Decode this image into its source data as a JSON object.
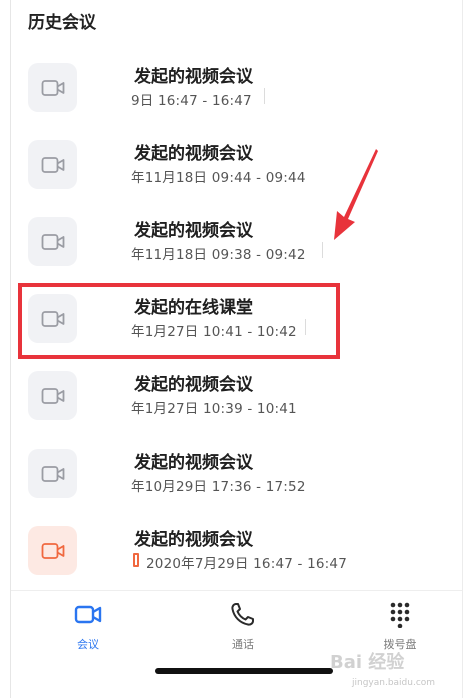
{
  "section_title": "历史会议",
  "meetings": [
    {
      "title": "发起的视频会议",
      "time": "9日 16:47 - 16:47",
      "icon": "video-camera-icon",
      "accent": false
    },
    {
      "title": "发起的视频会议",
      "time": "年11月18日 09:44 - 09:44",
      "icon": "video-camera-icon",
      "accent": false
    },
    {
      "title": "发起的视频会议",
      "time": "年11月18日 09:38 - 09:42",
      "icon": "video-camera-icon",
      "accent": false
    },
    {
      "title": "发起的在线课堂",
      "time": "年1月27日 10:41 - 10:42",
      "icon": "video-camera-icon",
      "accent": false
    },
    {
      "title": "发起的视频会议",
      "time": "年1月27日 10:39 - 10:41",
      "icon": "video-camera-icon",
      "accent": false
    },
    {
      "title": "发起的视频会议",
      "time": "年10月29日 17:36 - 17:52",
      "icon": "video-camera-icon",
      "accent": false
    },
    {
      "title": "发起的视频会议",
      "time": "2020年7月29日 16:47 - 16:47",
      "icon": "video-camera-icon",
      "accent": true
    }
  ],
  "tabs": [
    {
      "label": "会议",
      "icon": "video-camera-icon",
      "active": true
    },
    {
      "label": "通话",
      "icon": "phone-icon",
      "active": false
    },
    {
      "label": "拨号盘",
      "icon": "dialpad-icon",
      "active": false
    }
  ],
  "watermark": {
    "text": "Bai 经验",
    "sub": "jingyan.baidu.com"
  },
  "colors": {
    "accent_blue": "#2a75f0",
    "accent_orange": "#f0683f",
    "highlight_red": "#e8333b",
    "icon_gray": "#9a9ca3"
  }
}
